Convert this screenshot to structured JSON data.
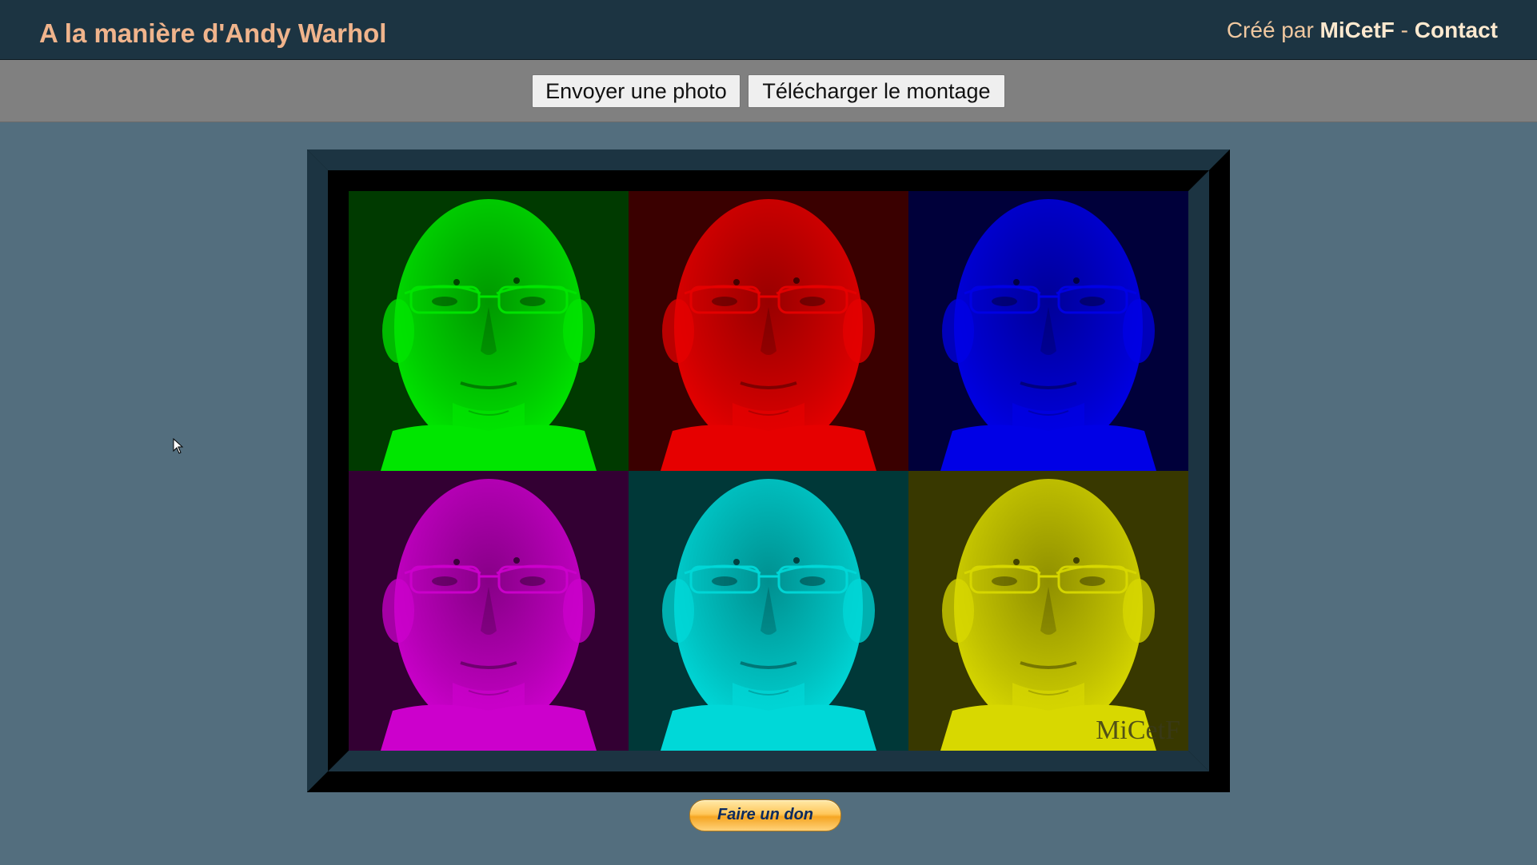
{
  "header": {
    "title": "A la manière d'Andy Warhol",
    "credit_prefix": "Créé par",
    "author_link": "MiCetF",
    "separator": "-",
    "contact_link": "Contact"
  },
  "toolbar": {
    "upload_label": "Envoyer une photo",
    "download_label": "Télécharger le montage"
  },
  "montage": {
    "watermark": "MiCetF",
    "panels": [
      {
        "tint": "green",
        "color": "#00e600",
        "bg": "#003a00"
      },
      {
        "tint": "red",
        "color": "#e60000",
        "bg": "#3a0000"
      },
      {
        "tint": "blue",
        "color": "#0000e6",
        "bg": "#00003a"
      },
      {
        "tint": "magenta",
        "color": "#cc00cc",
        "bg": "#330033"
      },
      {
        "tint": "cyan",
        "color": "#00d8d8",
        "bg": "#003838"
      },
      {
        "tint": "yellow",
        "color": "#d8d800",
        "bg": "#383800"
      }
    ]
  },
  "donate": {
    "label": "Faire un don"
  },
  "colors": {
    "header_bg": "#1c3442",
    "title": "#f0b48c",
    "toolbar_bg": "#808080",
    "page_bg": "#536e7e"
  }
}
